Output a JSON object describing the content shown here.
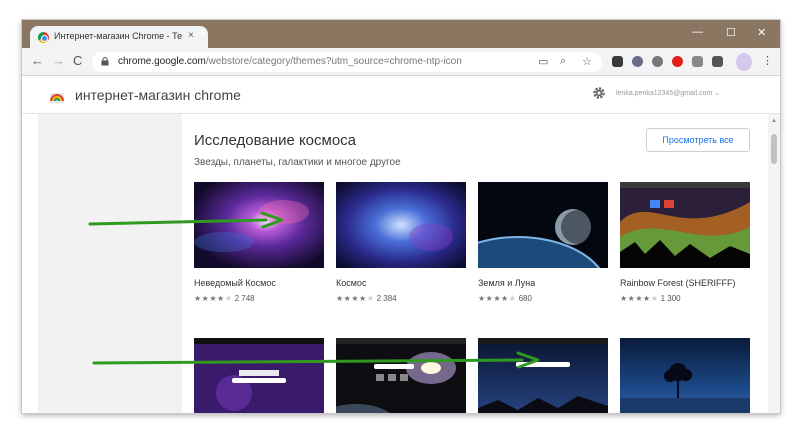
{
  "browser": {
    "tab_title": "Интернет-магазин Chrome - Те",
    "tab_close": "×",
    "new_tab": "+",
    "win_minimize": "—",
    "win_restore": "☐",
    "win_close": "✕",
    "back": "←",
    "forward": "→",
    "reload": "C",
    "url_host": "chrome.google.com",
    "url_path": "/webstore/category/themes?utm_source=chrome-ntp-icon",
    "menu": "⋮"
  },
  "store": {
    "title": "интернет-магазин chrome",
    "account_email": "lenka.penka12345@gmail.com ⌄"
  },
  "section": {
    "title": "Исследование космоса",
    "subtitle": "Звезды, планеты, галактики и многое другое",
    "view_all": "Просмотреть все"
  },
  "themes": [
    {
      "name": "Неведомый Космос",
      "stars": "★★★★",
      "half": "★",
      "count": "2 748"
    },
    {
      "name": "Космос",
      "stars": "★★★★",
      "half": "★",
      "count": "2 384"
    },
    {
      "name": "Земля и Луна",
      "stars": "★★★★",
      "half": "★",
      "count": "680"
    },
    {
      "name": "Rainbow Forest (SHERIFFF)",
      "stars": "★★★★",
      "half": "★",
      "count": "1 300"
    }
  ],
  "colors": {
    "tabstrip": "#8b7761",
    "arrow": "#2f9a1f",
    "link": "#1a73e8"
  }
}
